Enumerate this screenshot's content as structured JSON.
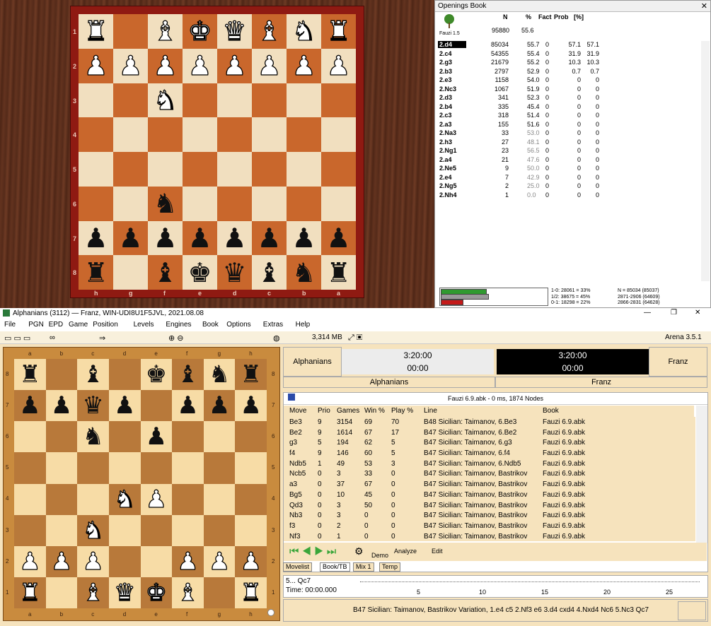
{
  "board1": {
    "rows": [
      [
        "wR",
        "",
        "wB",
        "wK",
        "wQ",
        "wB",
        "wN",
        "wR"
      ],
      [
        "wP",
        "wP",
        "wP",
        "wP",
        "wP",
        "wP",
        "wP",
        "wP"
      ],
      [
        "",
        "",
        "wN",
        "",
        "",
        "",
        "",
        ""
      ],
      [
        "",
        "",
        "",
        "",
        "",
        "",
        "",
        ""
      ],
      [
        "",
        "",
        "",
        "",
        "",
        "",
        "",
        ""
      ],
      [
        "",
        "",
        "bN",
        "",
        "",
        "",
        "",
        ""
      ],
      [
        "bP",
        "bP",
        "bP",
        "bP",
        "bP",
        "bP",
        "bP",
        "bP"
      ],
      [
        "bR",
        "",
        "bB",
        "bK",
        "bQ",
        "bB",
        "bN",
        "bR"
      ]
    ],
    "ranks": [
      "1",
      "2",
      "3",
      "4",
      "5",
      "6",
      "7",
      "8"
    ],
    "files": [
      "h",
      "g",
      "f",
      "e",
      "d",
      "c",
      "b",
      "a"
    ]
  },
  "book": {
    "title": "Openings Book",
    "close": "✕",
    "headers": {
      "n": "N",
      "pct": "%",
      "fact": "Fact",
      "prob": "Prob",
      "brk": "[%]"
    },
    "owner": "Fauzi 1.5",
    "total_n": "95880",
    "total_pct": "55.6",
    "rows": [
      {
        "m": "2.d4",
        "n": "85034",
        "p": "55.7",
        "f": "0",
        "pr": "57.1",
        "b": "57.1"
      },
      {
        "m": "2.c4",
        "n": "54355",
        "p": "55.4",
        "f": "0",
        "pr": "31.9",
        "b": "31.9"
      },
      {
        "m": "2.g3",
        "n": "21679",
        "p": "55.2",
        "f": "0",
        "pr": "10.3",
        "b": "10.3"
      },
      {
        "m": "2.b3",
        "n": "2797",
        "p": "52.9",
        "f": "0",
        "pr": "0.7",
        "b": "0.7"
      },
      {
        "m": "2.e3",
        "n": "1158",
        "p": "54.0",
        "f": "0",
        "pr": "0",
        "b": "0"
      },
      {
        "m": "2.Nc3",
        "n": "1067",
        "p": "51.9",
        "f": "0",
        "pr": "0",
        "b": "0"
      },
      {
        "m": "2.d3",
        "n": "341",
        "p": "52.3",
        "f": "0",
        "pr": "0",
        "b": "0"
      },
      {
        "m": "2.b4",
        "n": "335",
        "p": "45.4",
        "f": "0",
        "pr": "0",
        "b": "0"
      },
      {
        "m": "2.c3",
        "n": "318",
        "p": "51.4",
        "f": "0",
        "pr": "0",
        "b": "0"
      },
      {
        "m": "2.a3",
        "n": "155",
        "p": "51.6",
        "f": "0",
        "pr": "0",
        "b": "0"
      },
      {
        "m": "2.Na3",
        "n": "33",
        "p": "53.0",
        "f": "0",
        "pr": "0",
        "b": "0"
      },
      {
        "m": "2.h3",
        "n": "27",
        "p": "48.1",
        "f": "0",
        "pr": "0",
        "b": "0"
      },
      {
        "m": "2.Ng1",
        "n": "23",
        "p": "56.5",
        "f": "0",
        "pr": "0",
        "b": "0"
      },
      {
        "m": "2.a4",
        "n": "21",
        "p": "47.6",
        "f": "0",
        "pr": "0",
        "b": "0"
      },
      {
        "m": "2.Ne5",
        "n": "9",
        "p": "50.0",
        "f": "0",
        "pr": "0",
        "b": "0"
      },
      {
        "m": "2.e4",
        "n": "7",
        "p": "42.9",
        "f": "0",
        "pr": "0",
        "b": "0"
      },
      {
        "m": "2.Ng5",
        "n": "2",
        "p": "25.0",
        "f": "0",
        "pr": "0",
        "b": "0"
      },
      {
        "m": "2.Nh4",
        "n": "1",
        "p": "0.0",
        "f": "0",
        "pr": "0",
        "b": "0"
      }
    ],
    "stats": {
      "l1": "1-0: 28061 = 33%",
      "l2": "1/2: 38675 = 45%",
      "l3": "0-1: 18298 = 22%",
      "r1": "N = 85034 (85037)",
      "r2": "2871-2906 (64609)",
      "r3": "2866-2831 (64628)"
    },
    "bars": {
      "win": 0.33,
      "draw": 0.45,
      "loss": 0.22
    }
  },
  "window": {
    "title": "Alphanians (3112) — Franz,  WIN-UDI8U1F5JVL,  2021.08.08",
    "min": "—",
    "max": "❐",
    "close": "✕"
  },
  "menu": [
    "File",
    "PGN",
    "EPD",
    "Game",
    "Position",
    "Levels",
    "Engines",
    "Book",
    "Options",
    "Extras",
    "Help"
  ],
  "toolbar": {
    "memory": "3,314 MB",
    "version": "Arena 3.5.1"
  },
  "board2": {
    "rows": [
      [
        "bR",
        "",
        "bB",
        "",
        "bK",
        "bB",
        "bN",
        "bR"
      ],
      [
        "bP",
        "bP",
        "bQ",
        "bP",
        "",
        "bP",
        "bP",
        "bP"
      ],
      [
        "",
        "",
        "bN",
        "",
        "bP",
        "",
        "",
        ""
      ],
      [
        "",
        "",
        "",
        "",
        "",
        "",
        "",
        ""
      ],
      [
        "",
        "",
        "",
        "wN",
        "wP",
        "",
        "",
        ""
      ],
      [
        "",
        "",
        "wN",
        "",
        "",
        "",
        "",
        ""
      ],
      [
        "wP",
        "wP",
        "wP",
        "",
        "",
        "wP",
        "wP",
        "wP"
      ],
      [
        "wR",
        "",
        "wB",
        "wQ",
        "wK",
        "wB",
        "",
        "wR"
      ]
    ],
    "ranks": [
      "8",
      "7",
      "6",
      "5",
      "4",
      "3",
      "2",
      "1"
    ],
    "files": [
      "a",
      "b",
      "c",
      "d",
      "e",
      "f",
      "g",
      "h"
    ]
  },
  "clock": {
    "white": "Alphanians",
    "black": "Franz",
    "wtime": "3:20:00",
    "wmove": "00:00",
    "btime": "3:20:00",
    "bmove": "00:00",
    "wname2": "Alphanians",
    "bname2": "Franz"
  },
  "analysis": {
    "header": "Fauzi 6.9.abk - 0 ms, 1874 Nodes",
    "cols": {
      "move": "Move",
      "prio": "Prio",
      "games": "Games",
      "win": "Win %",
      "play": "Play %",
      "line": "Line",
      "book": "Book"
    },
    "rows": [
      {
        "m": "Be3",
        "pr": "9",
        "g": "3154",
        "w": "69",
        "p": "70",
        "l": "B48  Sicilian: Taimanov, 6.Be3",
        "b": "Fauzi 6.9.abk"
      },
      {
        "m": "Be2",
        "pr": "9",
        "g": "1614",
        "w": "67",
        "p": "17",
        "l": "B47  Sicilian: Taimanov, 6.Be2",
        "b": "Fauzi 6.9.abk"
      },
      {
        "m": "g3",
        "pr": "5",
        "g": "194",
        "w": "62",
        "p": "5",
        "l": "B47  Sicilian: Taimanov, 6.g3",
        "b": "Fauzi 6.9.abk"
      },
      {
        "m": "f4",
        "pr": "9",
        "g": "146",
        "w": "60",
        "p": "5",
        "l": "B47  Sicilian: Taimanov, 6.f4",
        "b": "Fauzi 6.9.abk"
      },
      {
        "m": "Ndb5",
        "pr": "1",
        "g": "49",
        "w": "53",
        "p": "3",
        "l": "B47  Sicilian: Taimanov, 6.Ndb5",
        "b": "Fauzi 6.9.abk"
      },
      {
        "m": "Ncb5",
        "pr": "0",
        "g": "3",
        "w": "33",
        "p": "0",
        "l": "B47  Sicilian: Taimanov, Bastrikov",
        "b": "Fauzi 6.9.abk"
      },
      {
        "m": "a3",
        "pr": "0",
        "g": "37",
        "w": "67",
        "p": "0",
        "l": "B47  Sicilian: Taimanov, Bastrikov",
        "b": "Fauzi 6.9.abk"
      },
      {
        "m": "Bg5",
        "pr": "0",
        "g": "10",
        "w": "45",
        "p": "0",
        "l": "B47  Sicilian: Taimanov, Bastrikov",
        "b": "Fauzi 6.9.abk"
      },
      {
        "m": "Qd3",
        "pr": "0",
        "g": "3",
        "w": "50",
        "p": "0",
        "l": "B47  Sicilian: Taimanov, Bastrikov",
        "b": "Fauzi 6.9.abk"
      },
      {
        "m": "Nb3",
        "pr": "0",
        "g": "3",
        "w": "0",
        "p": "0",
        "l": "B47  Sicilian: Taimanov, Bastrikov",
        "b": "Fauzi 6.9.abk"
      },
      {
        "m": "f3",
        "pr": "0",
        "g": "2",
        "w": "0",
        "p": "0",
        "l": "B47  Sicilian: Taimanov, Bastrikov",
        "b": "Fauzi 6.9.abk"
      },
      {
        "m": "Nf3",
        "pr": "0",
        "g": "1",
        "w": "0",
        "p": "0",
        "l": "B47  Sicilian: Taimanov, Bastrikov",
        "b": "Fauzi 6.9.abk"
      }
    ],
    "demo": "Demo",
    "analyze": "Analyze",
    "edit": "Edit"
  },
  "tabs": [
    "Movelist",
    "Book/TB",
    "Mix 1",
    "Temp"
  ],
  "movebox": {
    "move": "5... Qc7",
    "time": "Time: 00:00.000",
    "ticks": [
      "5",
      "10",
      "15",
      "20",
      "25"
    ]
  },
  "status": {
    "text": "B47  Sicilian: Taimanov, Bastrikov Variation, 1.e4 c5 2.Nf3 e6 3.d4 cxd4 4.Nxd4 Nc6 5.Nc3 Qc7"
  }
}
